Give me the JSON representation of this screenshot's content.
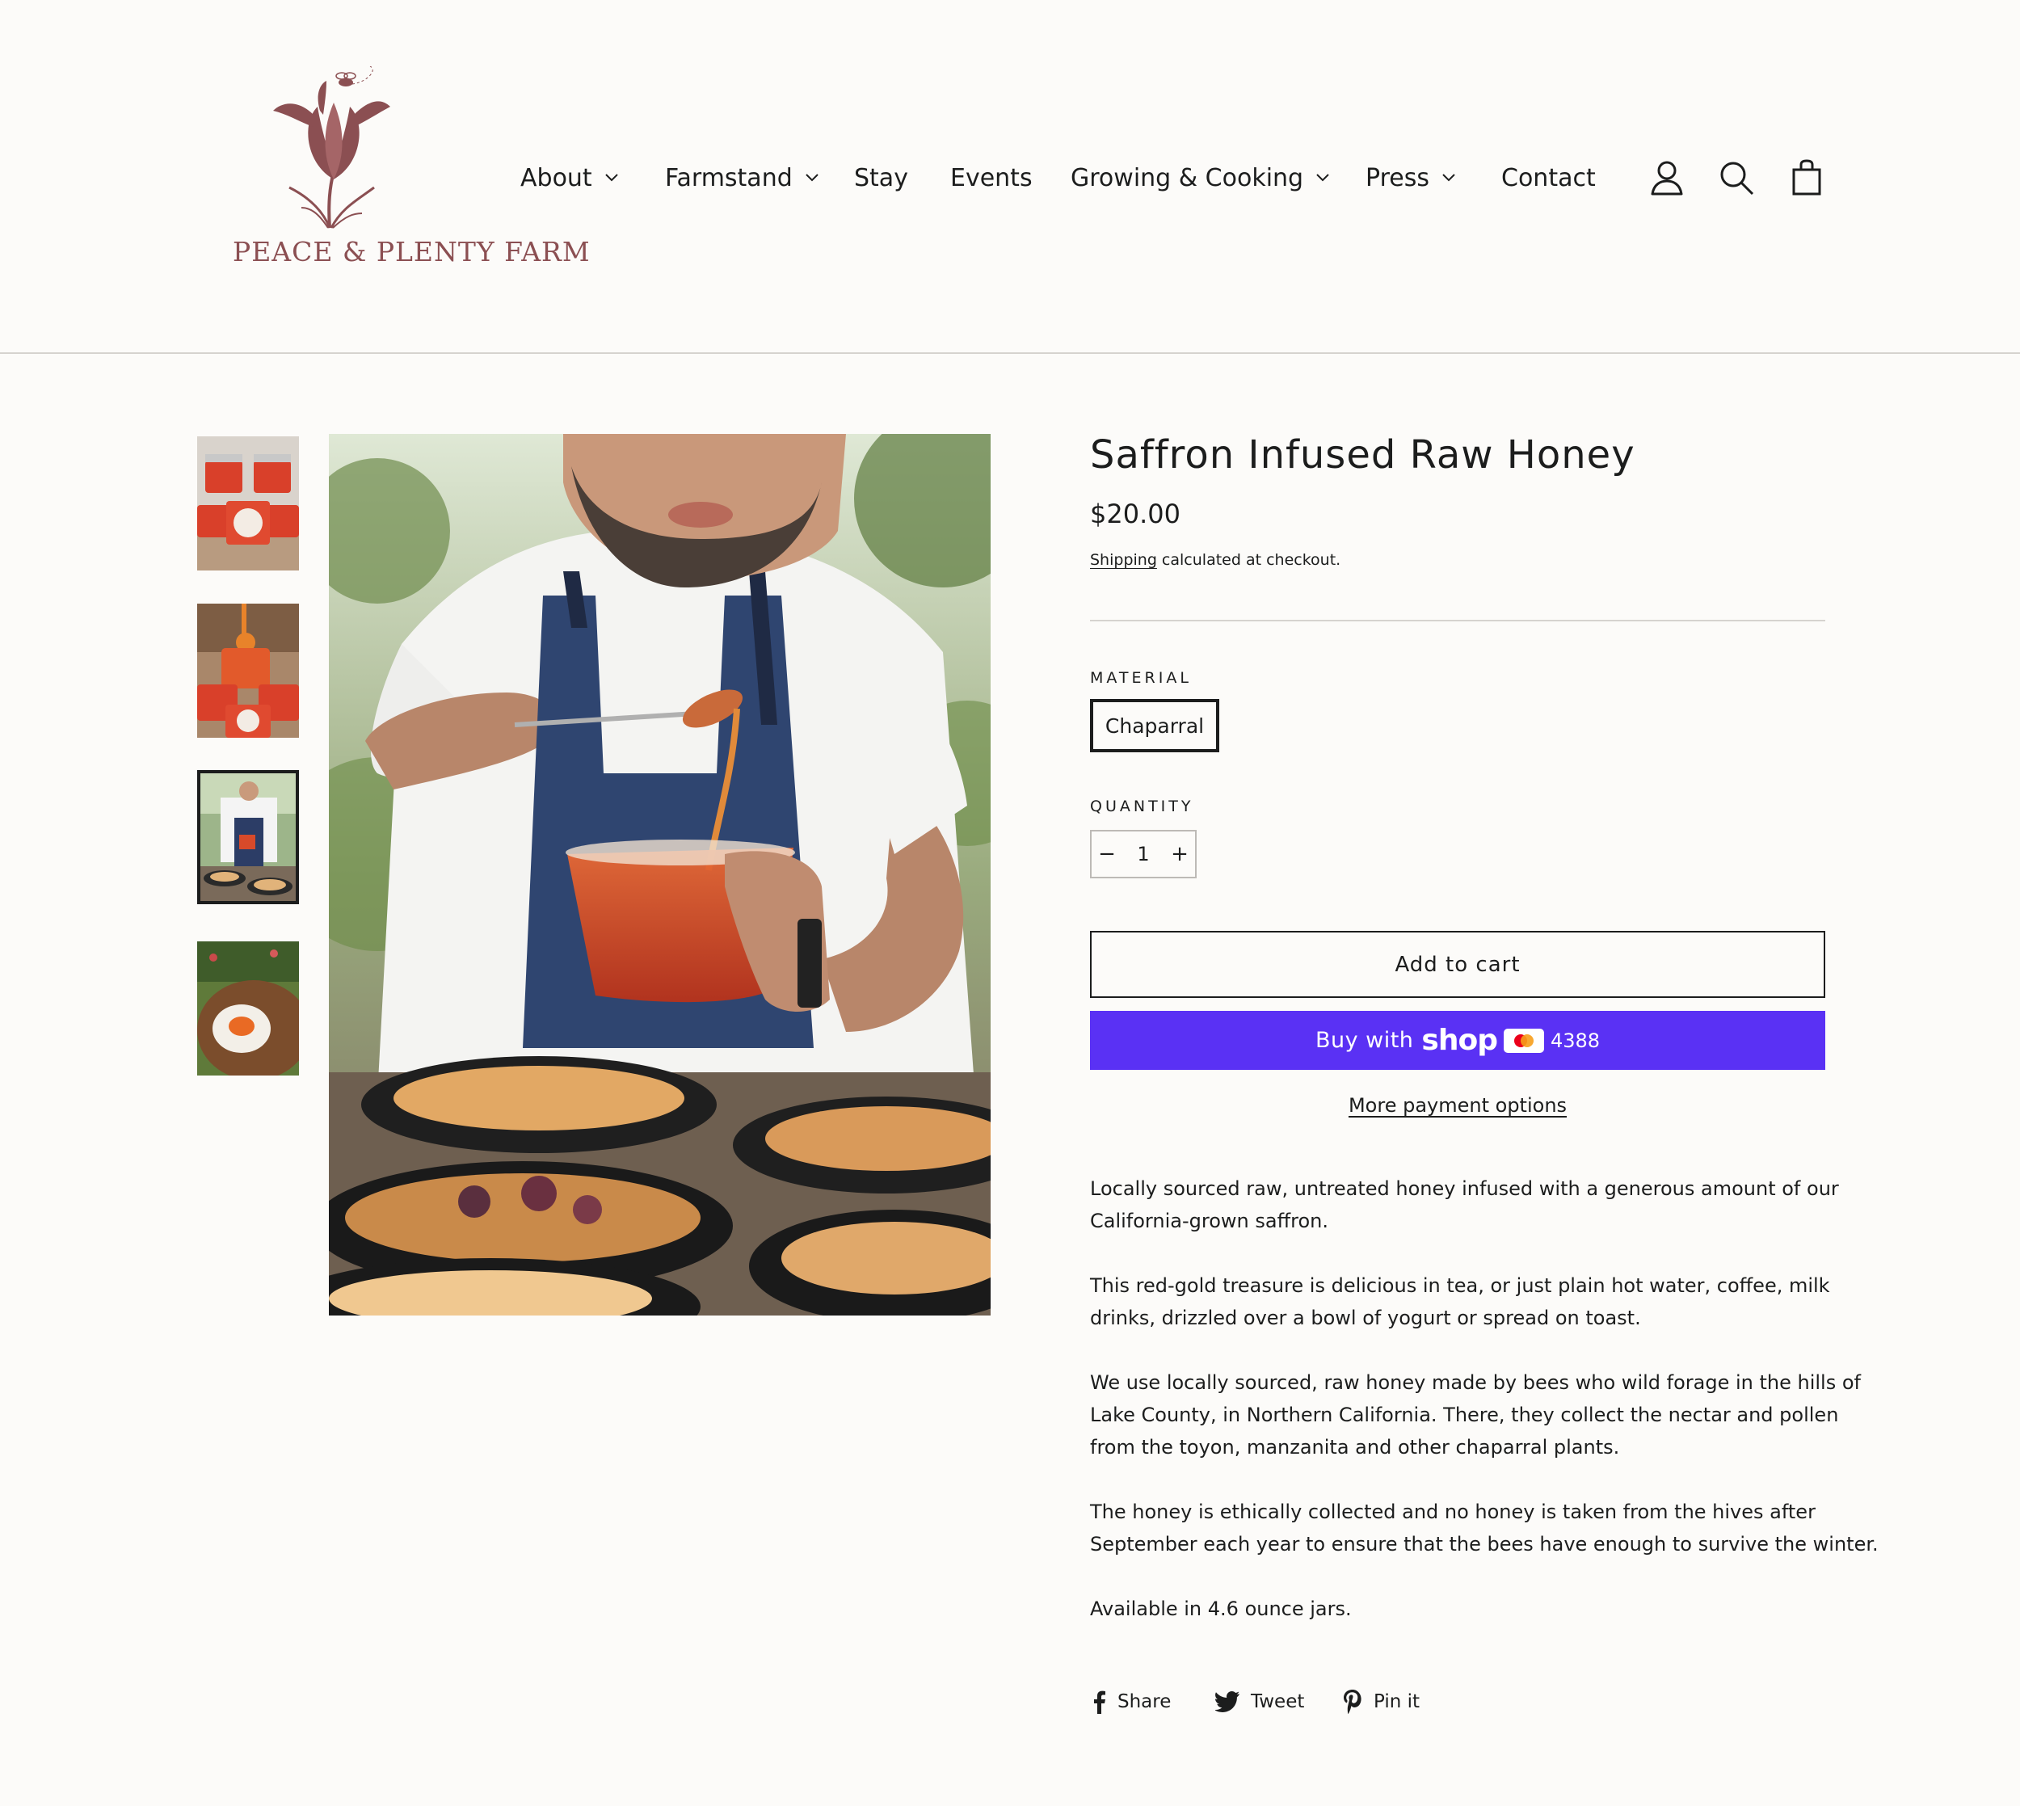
{
  "brand": {
    "logo_text": "PEACE & PLENTY FARM",
    "logo_color": "#8b4f52"
  },
  "nav": {
    "items": [
      {
        "label": "About",
        "has_dropdown": true
      },
      {
        "label": "Farmstand",
        "has_dropdown": true
      },
      {
        "label": "Stay",
        "has_dropdown": false
      },
      {
        "label": "Events",
        "has_dropdown": false
      },
      {
        "label": "Growing & Cooking",
        "has_dropdown": true
      },
      {
        "label": "Press",
        "has_dropdown": true
      },
      {
        "label": "Contact",
        "has_dropdown": false
      }
    ],
    "icons": [
      "account-icon",
      "search-icon",
      "cart-icon"
    ]
  },
  "gallery": {
    "thumbnail_count": 4,
    "active_thumbnail": 3
  },
  "product": {
    "title": "Saffron Infused Raw Honey",
    "price": "$20.00",
    "shipping_link": "Shipping",
    "shipping_rest": " calculated at checkout.",
    "material_label": "MATERIAL",
    "material_value": "Chaparral",
    "quantity_label": "QUANTITY",
    "quantity_value": "1",
    "qty_minus": "−",
    "qty_plus": "+",
    "add_to_cart": "Add to cart",
    "shop_pay": {
      "buy_text": "Buy with",
      "shop_word": "shop",
      "card_last4": "4388",
      "color": "#5a31f4"
    },
    "more_payment": "More payment options",
    "description": [
      "Locally sourced raw, untreated honey infused with a generous amount of our",
      "California-grown saffron.",
      "This red-gold treasure is delicious in tea, or just plain hot water, coffee, milk",
      "drinks, drizzled over a bowl of yogurt or spread on toast.",
      "We use locally sourced, raw honey made by bees who wild forage in the hills of",
      "Lake County, in Northern California. There, they collect the nectar and pollen",
      "from the toyon, manzanita and other chaparral plants.",
      "The honey is ethically collected and no honey is taken from the hives after",
      "September each year to ensure that the bees have enough to survive the winter.",
      "Available in 4.6 ounce jars."
    ]
  },
  "social": {
    "share": "Share",
    "tweet": "Tweet",
    "pin": "Pin it"
  }
}
